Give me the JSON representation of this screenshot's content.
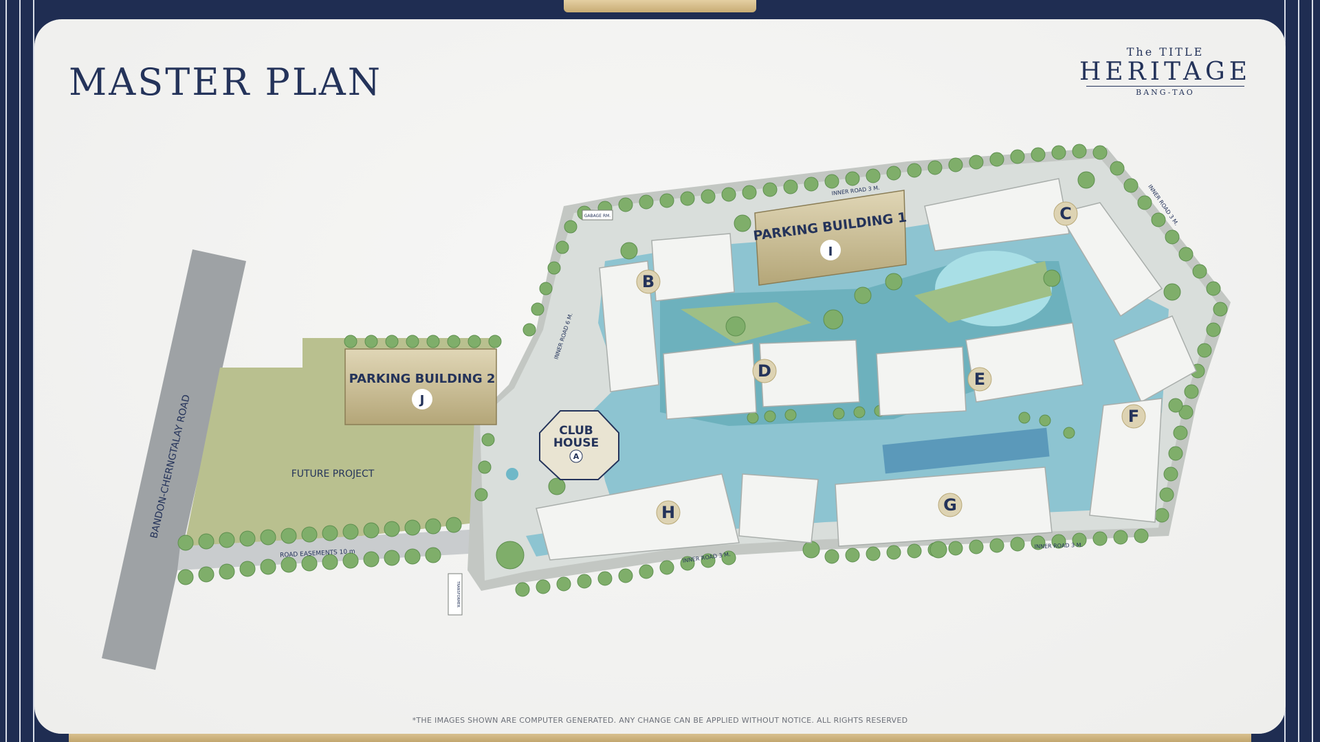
{
  "page": {
    "title": "MASTER PLAN",
    "disclaimer": "*THE IMAGES SHOWN ARE COMPUTER GENERATED. ANY CHANGE CAN BE APPLIED WITHOUT NOTICE. ALL RIGHTS RESERVED"
  },
  "brand": {
    "top": "The TITLE",
    "main": "HERITAGE",
    "sub": "BANG-TAO"
  },
  "colors": {
    "navy": "#24335a",
    "gold": "#c8ac74",
    "water": "#6fb8c8",
    "lawn": "#b8c48e",
    "trees": "#7fae6a",
    "roads": "#a9aeb2"
  },
  "map": {
    "road_main": "BANDON-CHERNGTALAY ROAD",
    "future_project": "FUTURE PROJECT",
    "road_easements": "ROAD EASEMENTS 10 m",
    "inner_road_top": "INNER ROAD 3 M.",
    "inner_road_left": "INNER ROAD 6 M.",
    "inner_road_right": "INNER ROAD 3 M.",
    "inner_road_bottom_mid": "INNER ROAD 3 M.",
    "inner_road_bottom_right": "INNER ROAD 3 M.",
    "garbage": "GABAGE RM.",
    "transformer": "TRANSFORMER",
    "parking1_label": "PARKING BUILDING 1",
    "parking1_code": "I",
    "parking2_label": "PARKING BUILDING 2",
    "parking2_code": "J",
    "clubhouse_line1": "CLUB",
    "clubhouse_line2": "HOUSE",
    "clubhouse_code": "A",
    "buildings": [
      "B",
      "C",
      "D",
      "E",
      "F",
      "G",
      "H"
    ]
  }
}
